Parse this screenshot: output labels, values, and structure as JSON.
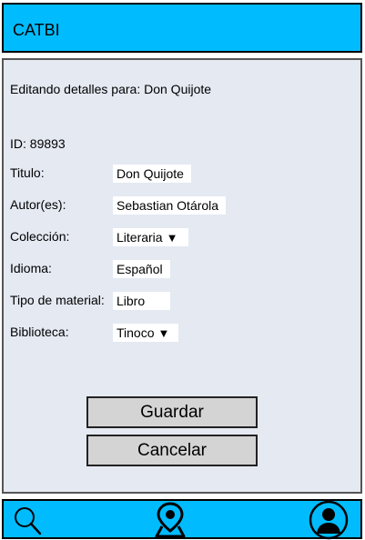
{
  "app": {
    "title": "CATBI"
  },
  "form": {
    "editing_text": "Editando detalles para: Don Quijote",
    "id_text": "ID: 89893",
    "fields": [
      {
        "label": "Titulo:",
        "value": "Don Quijote"
      },
      {
        "label": "Autor(es):",
        "value": "Sebastian Otárola"
      },
      {
        "label": "Colección:",
        "value": "Literaria",
        "dropdown_arrow": "▼"
      },
      {
        "label": "Idioma:",
        "value": "Español"
      },
      {
        "label": "Tipo de material:",
        "value": "Libro"
      },
      {
        "label": "Biblioteca:",
        "value": "Tinoco",
        "dropdown_arrow": "▼"
      }
    ]
  },
  "buttons": {
    "save": "Guardar",
    "cancel": "Cancelar"
  },
  "nav": {
    "icons": [
      "search-icon",
      "map-pin-icon",
      "user-icon"
    ]
  },
  "colors": {
    "accent": "#00bcff",
    "panel": "#e4e9f2",
    "button": "#d4d4d4"
  }
}
